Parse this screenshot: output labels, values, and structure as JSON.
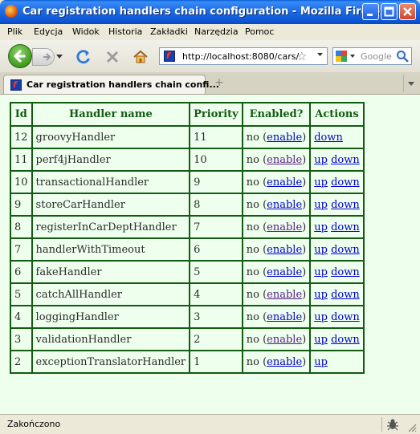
{
  "window": {
    "title": "Car registration handlers chain configuration - Mozilla Firefox"
  },
  "menu": [
    "Plik",
    "Edycja",
    "Widok",
    "Historia",
    "Zakładki",
    "Narzędzia",
    "Pomoc"
  ],
  "navbar": {
    "url": "http://localhost:8080/cars/",
    "search_placeholder": "Google"
  },
  "tab": {
    "label": "Car registration handlers chain confi..."
  },
  "table": {
    "headers": [
      "Id",
      "Handler name",
      "Priority",
      "Enabled?",
      "Actions"
    ],
    "rows": [
      {
        "id": "12",
        "name": "groovyHandler",
        "priority": "11",
        "enabled_text": "no (",
        "enable_link": "enable",
        "close": ")",
        "up": "",
        "down": "down"
      },
      {
        "id": "11",
        "name": "perf4jHandler",
        "priority": "10",
        "enabled_text": "no (",
        "enable_link": "enable",
        "close": ")",
        "up": "up",
        "down": "down"
      },
      {
        "id": "10",
        "name": "transactionalHandler",
        "priority": "9",
        "enabled_text": "no (",
        "enable_link": "enable",
        "close": ")",
        "up": "up",
        "down": "down"
      },
      {
        "id": "9",
        "name": "storeCarHandler",
        "priority": "8",
        "enabled_text": "no (",
        "enable_link": "enable",
        "close": ")",
        "up": "up",
        "down": "down"
      },
      {
        "id": "8",
        "name": "registerInCarDeptHandler",
        "priority": "7",
        "enabled_text": "no (",
        "enable_link": "enable",
        "close": ")",
        "up": "up",
        "down": "down"
      },
      {
        "id": "7",
        "name": "handlerWithTimeout",
        "priority": "6",
        "enabled_text": "no (",
        "enable_link": "enable",
        "close": ")",
        "up": "up",
        "down": "down"
      },
      {
        "id": "6",
        "name": "fakeHandler",
        "priority": "5",
        "enabled_text": "no (",
        "enable_link": "enable",
        "close": ")",
        "up": "up",
        "down": "down"
      },
      {
        "id": "5",
        "name": "catchAllHandler",
        "priority": "4",
        "enabled_text": "no (",
        "enable_link": "enable",
        "close": ")",
        "up": "up",
        "down": "down"
      },
      {
        "id": "4",
        "name": "loggingHandler",
        "priority": "3",
        "enabled_text": "no (",
        "enable_link": "enable",
        "close": ")",
        "up": "up",
        "down": "down"
      },
      {
        "id": "3",
        "name": "validationHandler",
        "priority": "2",
        "enabled_text": "no (",
        "enable_link": "enable",
        "close": ")",
        "up": "up",
        "down": "down"
      },
      {
        "id": "2",
        "name": "exceptionTranslatorHandler",
        "priority": "1",
        "enabled_text": "no (",
        "enable_link": "enable",
        "close": ")",
        "up": "up",
        "down": ""
      }
    ]
  },
  "status": {
    "text": "Zakończono"
  },
  "colors": {
    "page_background": "#eeffee",
    "table_border": "#135a13",
    "header_text": "#135a13",
    "link": "#0000cc",
    "visited_link": "#551a8b"
  }
}
